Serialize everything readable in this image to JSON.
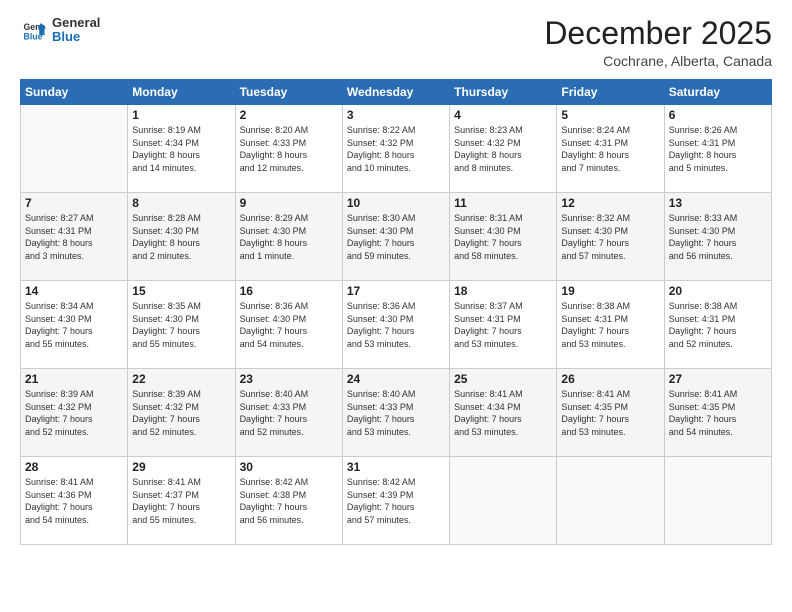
{
  "header": {
    "logo_general": "General",
    "logo_blue": "Blue",
    "month_year": "December 2025",
    "location": "Cochrane, Alberta, Canada"
  },
  "weekdays": [
    "Sunday",
    "Monday",
    "Tuesday",
    "Wednesday",
    "Thursday",
    "Friday",
    "Saturday"
  ],
  "weeks": [
    [
      {
        "day": "",
        "info": ""
      },
      {
        "day": "1",
        "info": "Sunrise: 8:19 AM\nSunset: 4:34 PM\nDaylight: 8 hours\nand 14 minutes."
      },
      {
        "day": "2",
        "info": "Sunrise: 8:20 AM\nSunset: 4:33 PM\nDaylight: 8 hours\nand 12 minutes."
      },
      {
        "day": "3",
        "info": "Sunrise: 8:22 AM\nSunset: 4:32 PM\nDaylight: 8 hours\nand 10 minutes."
      },
      {
        "day": "4",
        "info": "Sunrise: 8:23 AM\nSunset: 4:32 PM\nDaylight: 8 hours\nand 8 minutes."
      },
      {
        "day": "5",
        "info": "Sunrise: 8:24 AM\nSunset: 4:31 PM\nDaylight: 8 hours\nand 7 minutes."
      },
      {
        "day": "6",
        "info": "Sunrise: 8:26 AM\nSunset: 4:31 PM\nDaylight: 8 hours\nand 5 minutes."
      }
    ],
    [
      {
        "day": "7",
        "info": "Sunrise: 8:27 AM\nSunset: 4:31 PM\nDaylight: 8 hours\nand 3 minutes."
      },
      {
        "day": "8",
        "info": "Sunrise: 8:28 AM\nSunset: 4:30 PM\nDaylight: 8 hours\nand 2 minutes."
      },
      {
        "day": "9",
        "info": "Sunrise: 8:29 AM\nSunset: 4:30 PM\nDaylight: 8 hours\nand 1 minute."
      },
      {
        "day": "10",
        "info": "Sunrise: 8:30 AM\nSunset: 4:30 PM\nDaylight: 7 hours\nand 59 minutes."
      },
      {
        "day": "11",
        "info": "Sunrise: 8:31 AM\nSunset: 4:30 PM\nDaylight: 7 hours\nand 58 minutes."
      },
      {
        "day": "12",
        "info": "Sunrise: 8:32 AM\nSunset: 4:30 PM\nDaylight: 7 hours\nand 57 minutes."
      },
      {
        "day": "13",
        "info": "Sunrise: 8:33 AM\nSunset: 4:30 PM\nDaylight: 7 hours\nand 56 minutes."
      }
    ],
    [
      {
        "day": "14",
        "info": "Sunrise: 8:34 AM\nSunset: 4:30 PM\nDaylight: 7 hours\nand 55 minutes."
      },
      {
        "day": "15",
        "info": "Sunrise: 8:35 AM\nSunset: 4:30 PM\nDaylight: 7 hours\nand 55 minutes."
      },
      {
        "day": "16",
        "info": "Sunrise: 8:36 AM\nSunset: 4:30 PM\nDaylight: 7 hours\nand 54 minutes."
      },
      {
        "day": "17",
        "info": "Sunrise: 8:36 AM\nSunset: 4:30 PM\nDaylight: 7 hours\nand 53 minutes."
      },
      {
        "day": "18",
        "info": "Sunrise: 8:37 AM\nSunset: 4:31 PM\nDaylight: 7 hours\nand 53 minutes."
      },
      {
        "day": "19",
        "info": "Sunrise: 8:38 AM\nSunset: 4:31 PM\nDaylight: 7 hours\nand 53 minutes."
      },
      {
        "day": "20",
        "info": "Sunrise: 8:38 AM\nSunset: 4:31 PM\nDaylight: 7 hours\nand 52 minutes."
      }
    ],
    [
      {
        "day": "21",
        "info": "Sunrise: 8:39 AM\nSunset: 4:32 PM\nDaylight: 7 hours\nand 52 minutes."
      },
      {
        "day": "22",
        "info": "Sunrise: 8:39 AM\nSunset: 4:32 PM\nDaylight: 7 hours\nand 52 minutes."
      },
      {
        "day": "23",
        "info": "Sunrise: 8:40 AM\nSunset: 4:33 PM\nDaylight: 7 hours\nand 52 minutes."
      },
      {
        "day": "24",
        "info": "Sunrise: 8:40 AM\nSunset: 4:33 PM\nDaylight: 7 hours\nand 53 minutes."
      },
      {
        "day": "25",
        "info": "Sunrise: 8:41 AM\nSunset: 4:34 PM\nDaylight: 7 hours\nand 53 minutes."
      },
      {
        "day": "26",
        "info": "Sunrise: 8:41 AM\nSunset: 4:35 PM\nDaylight: 7 hours\nand 53 minutes."
      },
      {
        "day": "27",
        "info": "Sunrise: 8:41 AM\nSunset: 4:35 PM\nDaylight: 7 hours\nand 54 minutes."
      }
    ],
    [
      {
        "day": "28",
        "info": "Sunrise: 8:41 AM\nSunset: 4:36 PM\nDaylight: 7 hours\nand 54 minutes."
      },
      {
        "day": "29",
        "info": "Sunrise: 8:41 AM\nSunset: 4:37 PM\nDaylight: 7 hours\nand 55 minutes."
      },
      {
        "day": "30",
        "info": "Sunrise: 8:42 AM\nSunset: 4:38 PM\nDaylight: 7 hours\nand 56 minutes."
      },
      {
        "day": "31",
        "info": "Sunrise: 8:42 AM\nSunset: 4:39 PM\nDaylight: 7 hours\nand 57 minutes."
      },
      {
        "day": "",
        "info": ""
      },
      {
        "day": "",
        "info": ""
      },
      {
        "day": "",
        "info": ""
      }
    ]
  ]
}
